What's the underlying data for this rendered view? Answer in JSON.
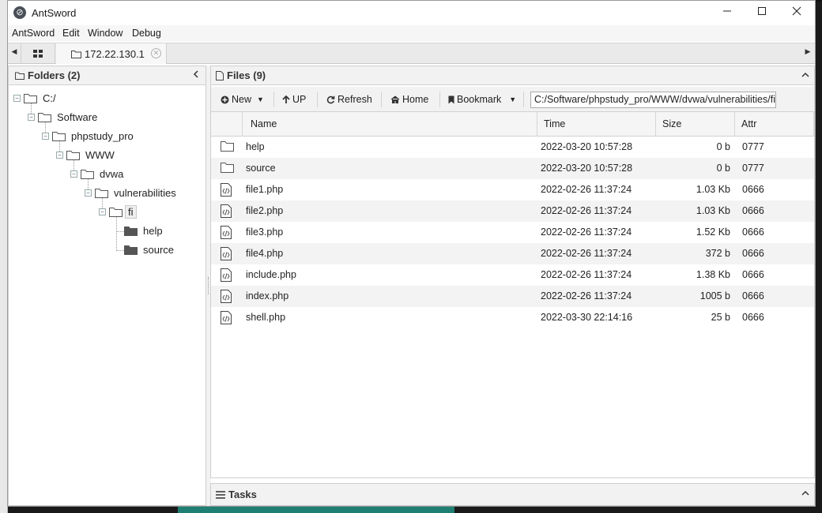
{
  "window": {
    "title": "AntSword",
    "app_icon": "antsword-logo-icon"
  },
  "menu": [
    "AntSword",
    "Edit",
    "Window",
    "Debug"
  ],
  "tabs": {
    "active": {
      "label": "172.22.130.1"
    }
  },
  "folders_panel": {
    "title": "Folders (2)",
    "tree": [
      {
        "name": "C:/"
      },
      {
        "name": "Software"
      },
      {
        "name": "phpstudy_pro"
      },
      {
        "name": "WWW"
      },
      {
        "name": "dvwa"
      },
      {
        "name": "vulnerabilities"
      },
      {
        "name": "fi"
      },
      {
        "name": "help"
      },
      {
        "name": "source"
      }
    ]
  },
  "files_panel": {
    "title": "Files (9)",
    "toolbar": {
      "new": "New",
      "up": "UP",
      "refresh": "Refresh",
      "home": "Home",
      "bookmark": "Bookmark",
      "path": "C:/Software/phpstudy_pro/WWW/dvwa/vulnerabilities/fi/"
    },
    "columns": {
      "name": "Name",
      "time": "Time",
      "size": "Size",
      "attr": "Attr"
    },
    "rows": [
      {
        "type": "folder",
        "name": "help",
        "time": "2022-03-20 10:57:28",
        "size": "0 b",
        "attr": "0777"
      },
      {
        "type": "folder",
        "name": "source",
        "time": "2022-03-20 10:57:28",
        "size": "0 b",
        "attr": "0777"
      },
      {
        "type": "php",
        "name": "file1.php",
        "time": "2022-02-26 11:37:24",
        "size": "1.03 Kb",
        "attr": "0666"
      },
      {
        "type": "php",
        "name": "file2.php",
        "time": "2022-02-26 11:37:24",
        "size": "1.03 Kb",
        "attr": "0666"
      },
      {
        "type": "php",
        "name": "file3.php",
        "time": "2022-02-26 11:37:24",
        "size": "1.52 Kb",
        "attr": "0666"
      },
      {
        "type": "php",
        "name": "file4.php",
        "time": "2022-02-26 11:37:24",
        "size": "372 b",
        "attr": "0666"
      },
      {
        "type": "php",
        "name": "include.php",
        "time": "2022-02-26 11:37:24",
        "size": "1.38 Kb",
        "attr": "0666"
      },
      {
        "type": "php",
        "name": "index.php",
        "time": "2022-02-26 11:37:24",
        "size": "1005 b",
        "attr": "0666"
      },
      {
        "type": "php",
        "name": "shell.php",
        "time": "2022-03-30 22:14:16",
        "size": "25 b",
        "attr": "0666"
      }
    ]
  },
  "tasks_panel": {
    "title": "Tasks"
  }
}
